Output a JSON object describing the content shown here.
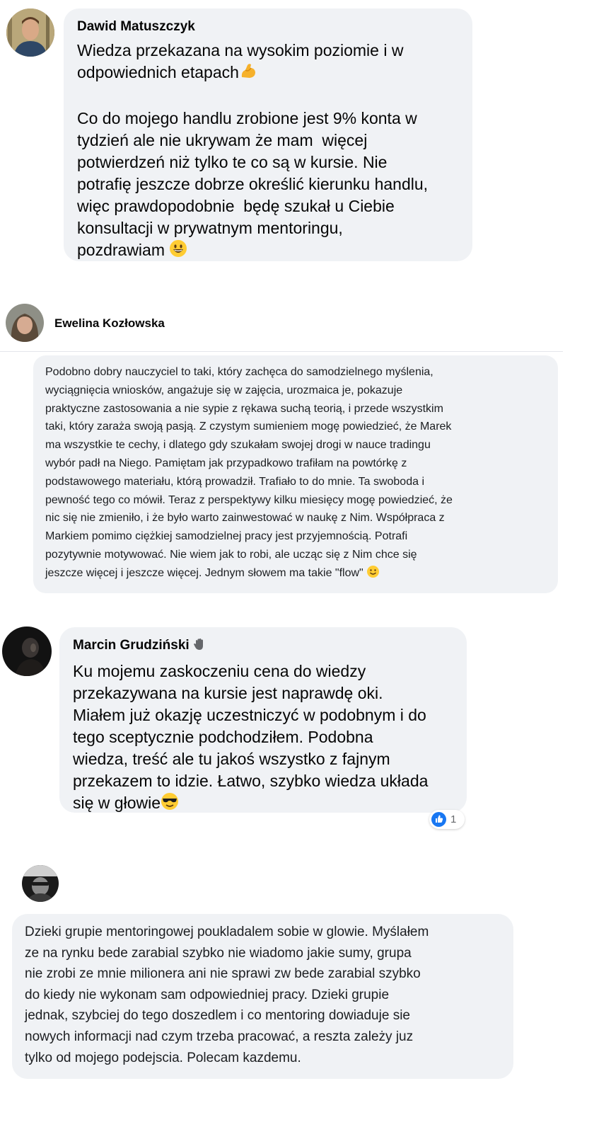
{
  "comments": [
    {
      "author": "Dawid Matuszczyk",
      "text": "Wiedza przekazana na wysokim poziomie i w\nodpowiednich etapach",
      "text2": "Co do mojego handlu zrobione jest 9% konta w\ntydzień ale nie ukrywam że mam  więcej\npotwierdzeń niż tylko te co są w kursie. Nie\npotrafię jeszcze dobrze określić kierunku handlu,\nwięc prawdopodobnie  będę szukał u Ciebie\nkonsultacji w prywatnym mentoringu,\npozdrawiam",
      "emoji1": "flexed-biceps",
      "emoji2": "grinning-face"
    },
    {
      "author": "Ewelina Kozłowska",
      "text": "Podobno dobry nauczyciel to taki, który zachęca do samodzielnego myślenia,\nwyciągnięcia wniosków, angażuje się w zajęcia, urozmaica je, pokazuje\npraktyczne zastosowania a nie sypie z rękawa suchą teorią, i przede wszystkim\ntaki, który zaraża swoją pasją. Z czystym sumieniem mogę powiedzieć, że Marek\nma wszystkie te cechy, i dlatego gdy szukałam swojej drogi w nauce tradingu\nwybór padł na Niego. Pamiętam jak przypadkowo trafiłam na powtórkę z\npodstawowego materiału, którą prowadził. Trafiało to do mnie. Ta swoboda i\npewność tego co mówił. Teraz z perspektywy kilku miesięcy mogę powiedzieć, że\nnic się nie zmieniło, i że było warto zainwestować w naukę z Nim. Współpraca z\nMarkiem pomimo ciężkiej samodzielnej pracy jest przyjemnością. Potrafi\npozytywnie motywować. Nie wiem jak to robi, ale ucząc się z Nim chce się\njeszcze więcej i jeszcze więcej. Jednym słowem ma takie \"flow\"",
      "emoji": "slightly-smiling-face"
    },
    {
      "author": "Marcin Grudziński",
      "badge_icon": "waving-hand-icon",
      "text": "Ku mojemu zaskoczeniu cena do wiedzy\nprzekazywana na kursie jest naprawdę oki.\nMiałem już okazję uczestniczyć w podobnym i do\ntego sceptycznie podchodziłem. Podobna\nwiedza, treść ale tu jakoś wszystko z fajnym\nprzekazem to idzie. Łatwo, szybko wiedza układa\nsię w głowie",
      "emoji": "smiling-face-with-sunglasses",
      "reaction_icon": "like-icon",
      "reaction_count": "1",
      "colors": {
        "like": "#1877f2"
      }
    },
    {
      "author": "",
      "text": "Dzieki grupie mentoringowej poukladalem sobie w glowie. Myślałem\nze na rynku bede zarabial szybko nie wiadomo jakie sumy, grupa\nnie zrobi ze mnie milionera ani nie sprawi zw bede zarabial szybko\ndo kiedy nie wykonam sam odpowiedniej pracy. Dzieki grupie\njednak, szybciej do tego doszedlem i co mentoring dowiaduje sie\nnowych informacji nad czym trzeba pracować, a reszta zależy juz\ntylko od mojego podejscia. Polecam kazdemu."
    }
  ],
  "colors": {
    "bubble": "#f0f2f5",
    "text": "#050505"
  }
}
